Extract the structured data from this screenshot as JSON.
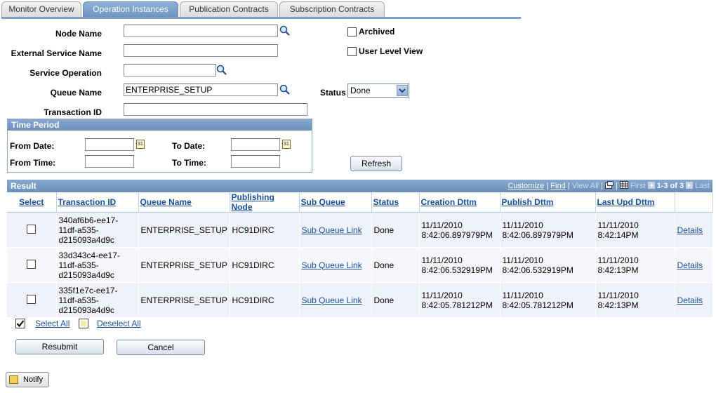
{
  "tabs": [
    "Monitor Overview",
    "Operation Instances",
    "Publication Contracts",
    "Subscription Contracts"
  ],
  "active_tab_index": 1,
  "form": {
    "node_name_label": "Node Name",
    "node_name_value": "",
    "external_service_label": "External Service Name",
    "external_service_value": "",
    "service_operation_label": "Service Operation",
    "service_operation_value": "",
    "queue_name_label": "Queue Name",
    "queue_name_value": "ENTERPRISE_SETUP",
    "transaction_id_label": "Transaction ID",
    "transaction_id_value": "",
    "archived_label": "Archived",
    "archived_checked": false,
    "user_level_view_label": "User Level View",
    "user_level_view_checked": false,
    "status_label": "Status",
    "status_value": "Done"
  },
  "time_period": {
    "title": "Time Period",
    "from_date_label": "From Date:",
    "to_date_label": "To Date:",
    "from_time_label": "From Time:",
    "to_time_label": "To Time:",
    "calendar_glyph": "31"
  },
  "refresh_label": "Refresh",
  "result": {
    "title": "Result",
    "customize": "Customize",
    "find": "Find",
    "view_all": "View All",
    "first": "First",
    "range": "1-3 of 3",
    "last": "Last",
    "separator": "|",
    "columns": [
      "Select",
      "Transaction ID",
      "Queue Name",
      "Publishing Node",
      "Sub Queue",
      "Status",
      "Creation Dttm",
      "Publish Dttm",
      "Last Upd Dttm",
      ""
    ],
    "rows": [
      {
        "transaction_id": "340af6b6-ee17-11df-a535-d215093a4d9c",
        "queue_name": "ENTERPRISE_SETUP",
        "publishing_node": "HC91DIRC",
        "sub_queue": "Sub Queue Link",
        "status": "Done",
        "creation_date": "11/11/2010",
        "creation_time": "8:42:06.897979PM",
        "publish_date": "11/11/2010",
        "publish_time": "8:42:06.897979PM",
        "last_upd_date": "11/11/2010",
        "last_upd_time": "8:42:14PM",
        "details": "Details"
      },
      {
        "transaction_id": "33d343c4-ee17-11df-a535-d215093a4d9c",
        "queue_name": "ENTERPRISE_SETUP",
        "publishing_node": "HC91DIRC",
        "sub_queue": "Sub Queue Link",
        "status": "Done",
        "creation_date": "11/11/2010",
        "creation_time": "8:42:06.532919PM",
        "publish_date": "11/11/2010",
        "publish_time": "8:42:06.532919PM",
        "last_upd_date": "11/11/2010",
        "last_upd_time": "8:42:13PM",
        "details": "Details"
      },
      {
        "transaction_id": "335f1e7c-ee17-11df-a535-d215093a4d9c",
        "queue_name": "ENTERPRISE_SETUP",
        "publishing_node": "HC91DIRC",
        "sub_queue": "Sub Queue Link",
        "status": "Done",
        "creation_date": "11/11/2010",
        "creation_time": "8:42:05.781212PM",
        "publish_date": "11/11/2010",
        "publish_time": "8:42:05.781212PM",
        "last_upd_date": "11/11/2010",
        "last_upd_time": "8:42:13PM",
        "details": "Details"
      }
    ]
  },
  "select_all_label": "Select All",
  "deselect_all_label": "Deselect All",
  "resubmit_label": "Resubmit",
  "cancel_label": "Cancel",
  "notify_label": "Notify",
  "colors": {
    "accent": "#6b8fbb",
    "link": "#1a4f9c"
  }
}
